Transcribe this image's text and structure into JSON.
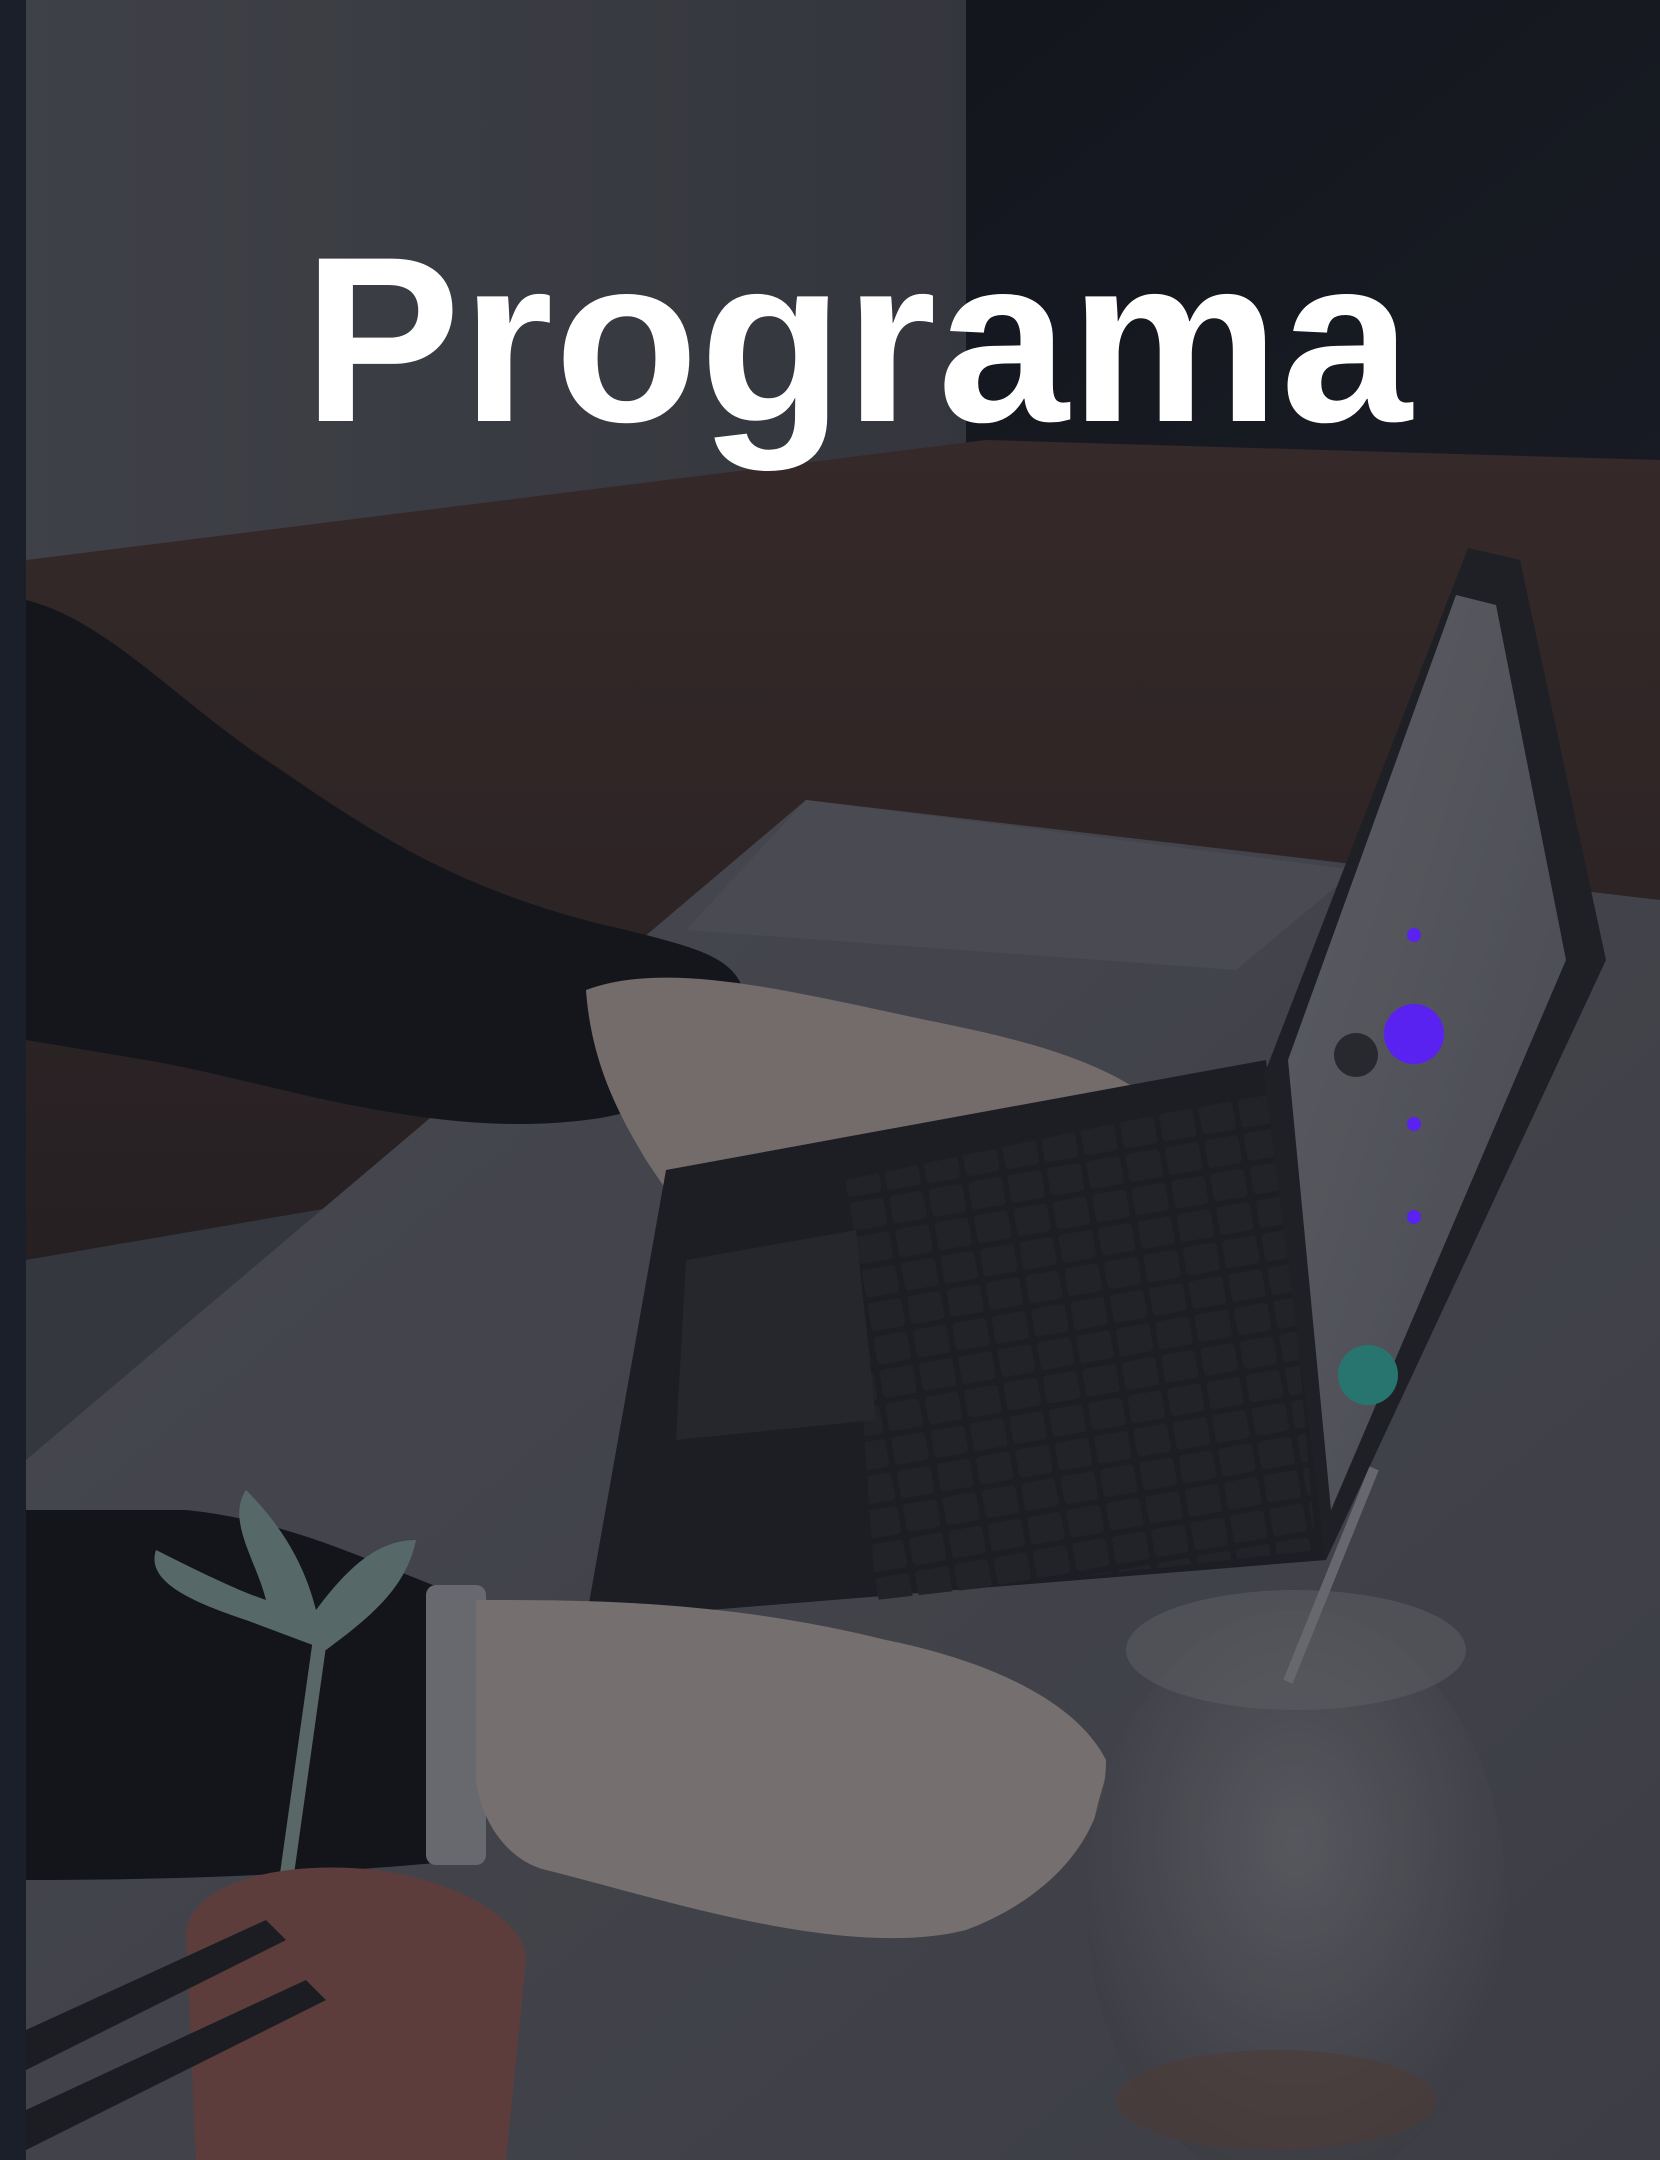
{
  "hero": {
    "title": "Programa"
  },
  "slider": {
    "dot_count": 4,
    "active_index": 1,
    "accent_color": "#5a22f0"
  },
  "icons": {
    "slide_dot": "dot-icon"
  }
}
